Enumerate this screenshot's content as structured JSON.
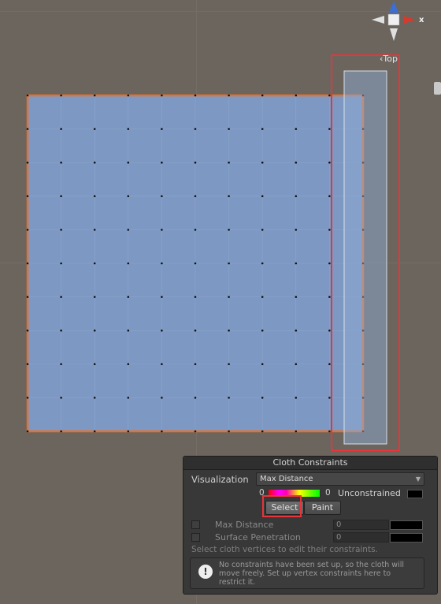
{
  "colors": {
    "background": "#6b655e",
    "plane_fill": "#7d99c3",
    "selection_outline": "#e8712a",
    "highlight_red": "#e8343b"
  },
  "scene": {
    "gizmo_label": "‹Top",
    "gizmo_axis_label": "x"
  },
  "panel": {
    "title": "Cloth Constraints",
    "visualization_label": "Visualization",
    "visualization_value": "Max Distance",
    "gradient_min": "0",
    "gradient_max": "0",
    "unconstrained_label": "Unconstrained",
    "select_button": "Select",
    "paint_button": "Paint",
    "rows": [
      {
        "label": "Max Distance",
        "value": "0"
      },
      {
        "label": "Surface Penetration",
        "value": "0"
      }
    ],
    "hint": "Select cloth vertices to edit their constraints.",
    "help_icon": "!",
    "help_text": "No constraints have been set up, so the cloth will move freely. Set up vertex constraints here to restrict it."
  }
}
